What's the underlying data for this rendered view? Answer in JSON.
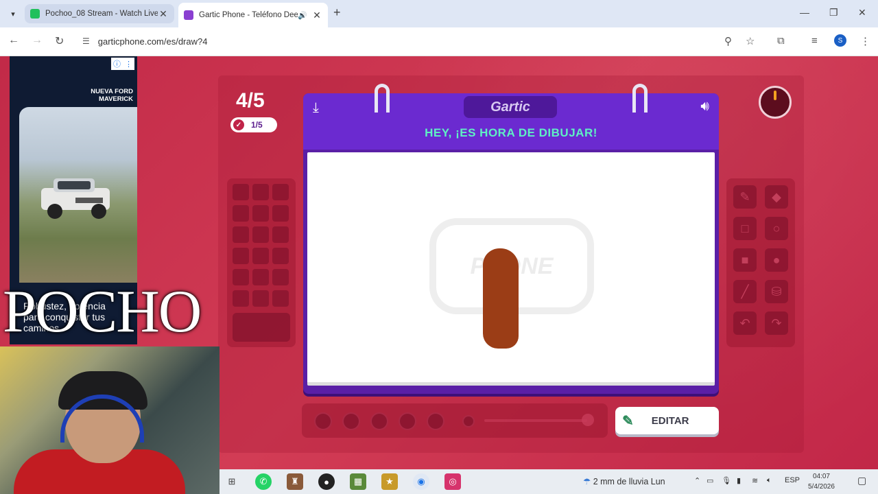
{
  "browser": {
    "tabs": [
      {
        "title": "Pochoo_08 Stream - Watch Live",
        "favicon_color": "#21c05c",
        "active": false
      },
      {
        "title": "Gartic Phone - Teléfono Dee",
        "favicon_color": "#8a3fd1",
        "active": true
      }
    ],
    "tab_list_icon": "chevron-down-icon",
    "new_tab_label": "+",
    "url": "garticphone.com/es/draw?4",
    "profile_initial": "S"
  },
  "ad": {
    "brand_line1": "NUEVA FORD",
    "brand_line2": "MAVERICK",
    "text": "Robustez, potencia para conquistar tus caminos"
  },
  "overlay": {
    "name": "POCHO"
  },
  "game": {
    "round": "4/5",
    "done_count": "1/5",
    "logo": "Gartic",
    "prompt": "HEY, ¡ES HORA DE DIBUJAR!",
    "watermark": "PHONE",
    "edit_button": "EDITAR",
    "stroke_color": "#9b3d16"
  },
  "taskbar": {
    "weather": "2 mm de lluvia Lun",
    "language": "ESP",
    "time": "04:07",
    "date": "5/4/2026"
  }
}
